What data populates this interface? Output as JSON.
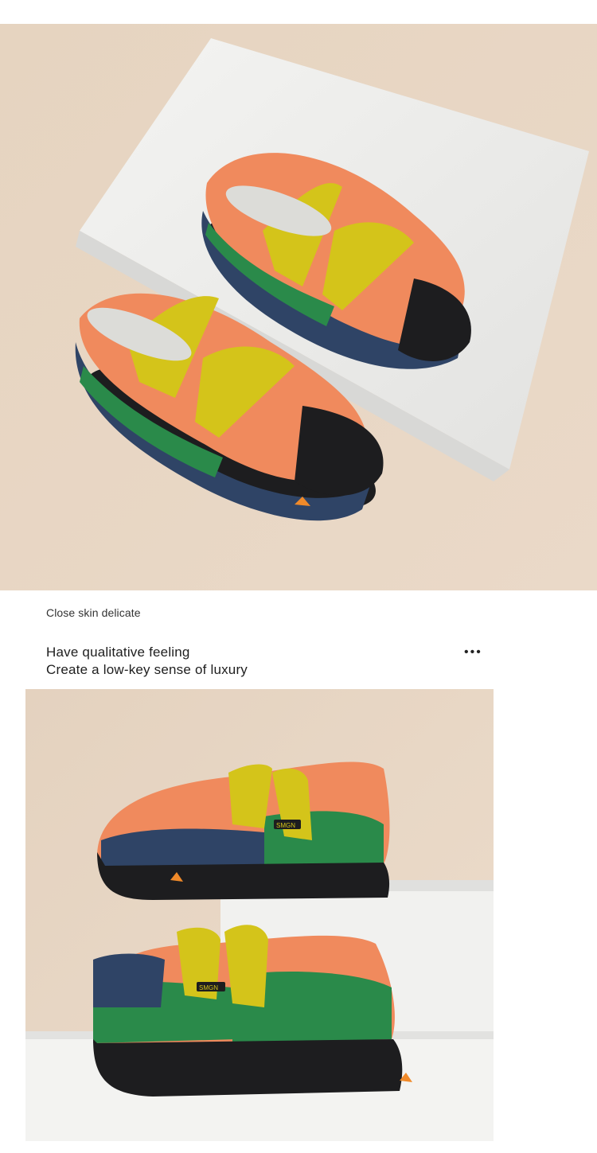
{
  "images": [
    {
      "id": "top",
      "subject": "pair of colorful children's sandal shoes on a white box"
    },
    {
      "id": "bottom",
      "subject": "two children's sandal shoes on stepped white blocks"
    }
  ],
  "caption": "Close skin delicate",
  "headline": {
    "line1": "Have qualitative feeling",
    "line2": "Create a low-key sense of luxury"
  },
  "more_icon": "ellipsis-icon",
  "shoe_label": "SMGN",
  "colors": {
    "background": "#ffffff",
    "photo_bg": "#e8d6c4",
    "orange_mesh": "#f08a5d",
    "yellow_strap": "#d4c41a",
    "navy": "#2f4466",
    "green": "#2a8a4a",
    "sole": "#1d1d1f"
  }
}
